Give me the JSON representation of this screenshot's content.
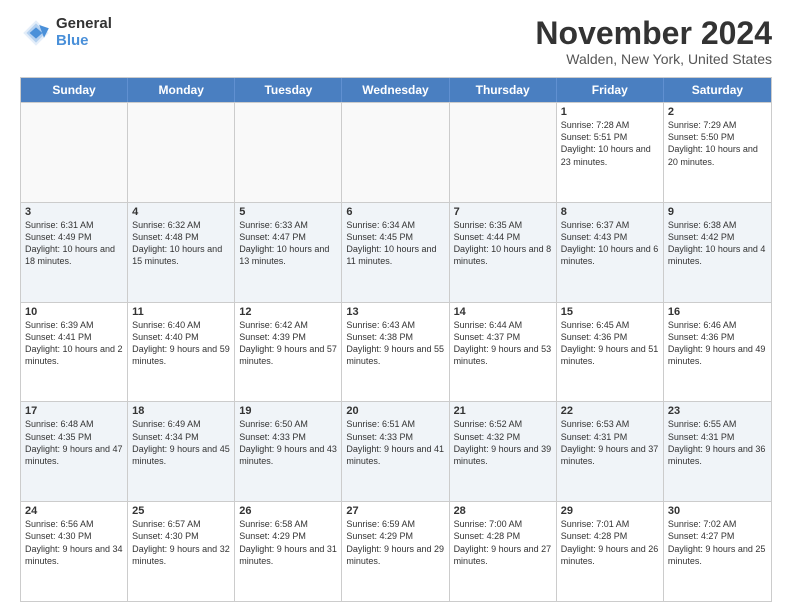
{
  "logo": {
    "general": "General",
    "blue": "Blue"
  },
  "title": "November 2024",
  "location": "Walden, New York, United States",
  "header_days": [
    "Sunday",
    "Monday",
    "Tuesday",
    "Wednesday",
    "Thursday",
    "Friday",
    "Saturday"
  ],
  "rows": [
    {
      "alt": false,
      "cells": [
        {
          "day": "",
          "info": ""
        },
        {
          "day": "",
          "info": ""
        },
        {
          "day": "",
          "info": ""
        },
        {
          "day": "",
          "info": ""
        },
        {
          "day": "",
          "info": ""
        },
        {
          "day": "1",
          "info": "Sunrise: 7:28 AM\nSunset: 5:51 PM\nDaylight: 10 hours and 23 minutes."
        },
        {
          "day": "2",
          "info": "Sunrise: 7:29 AM\nSunset: 5:50 PM\nDaylight: 10 hours and 20 minutes."
        }
      ]
    },
    {
      "alt": true,
      "cells": [
        {
          "day": "3",
          "info": "Sunrise: 6:31 AM\nSunset: 4:49 PM\nDaylight: 10 hours and 18 minutes."
        },
        {
          "day": "4",
          "info": "Sunrise: 6:32 AM\nSunset: 4:48 PM\nDaylight: 10 hours and 15 minutes."
        },
        {
          "day": "5",
          "info": "Sunrise: 6:33 AM\nSunset: 4:47 PM\nDaylight: 10 hours and 13 minutes."
        },
        {
          "day": "6",
          "info": "Sunrise: 6:34 AM\nSunset: 4:45 PM\nDaylight: 10 hours and 11 minutes."
        },
        {
          "day": "7",
          "info": "Sunrise: 6:35 AM\nSunset: 4:44 PM\nDaylight: 10 hours and 8 minutes."
        },
        {
          "day": "8",
          "info": "Sunrise: 6:37 AM\nSunset: 4:43 PM\nDaylight: 10 hours and 6 minutes."
        },
        {
          "day": "9",
          "info": "Sunrise: 6:38 AM\nSunset: 4:42 PM\nDaylight: 10 hours and 4 minutes."
        }
      ]
    },
    {
      "alt": false,
      "cells": [
        {
          "day": "10",
          "info": "Sunrise: 6:39 AM\nSunset: 4:41 PM\nDaylight: 10 hours and 2 minutes."
        },
        {
          "day": "11",
          "info": "Sunrise: 6:40 AM\nSunset: 4:40 PM\nDaylight: 9 hours and 59 minutes."
        },
        {
          "day": "12",
          "info": "Sunrise: 6:42 AM\nSunset: 4:39 PM\nDaylight: 9 hours and 57 minutes."
        },
        {
          "day": "13",
          "info": "Sunrise: 6:43 AM\nSunset: 4:38 PM\nDaylight: 9 hours and 55 minutes."
        },
        {
          "day": "14",
          "info": "Sunrise: 6:44 AM\nSunset: 4:37 PM\nDaylight: 9 hours and 53 minutes."
        },
        {
          "day": "15",
          "info": "Sunrise: 6:45 AM\nSunset: 4:36 PM\nDaylight: 9 hours and 51 minutes."
        },
        {
          "day": "16",
          "info": "Sunrise: 6:46 AM\nSunset: 4:36 PM\nDaylight: 9 hours and 49 minutes."
        }
      ]
    },
    {
      "alt": true,
      "cells": [
        {
          "day": "17",
          "info": "Sunrise: 6:48 AM\nSunset: 4:35 PM\nDaylight: 9 hours and 47 minutes."
        },
        {
          "day": "18",
          "info": "Sunrise: 6:49 AM\nSunset: 4:34 PM\nDaylight: 9 hours and 45 minutes."
        },
        {
          "day": "19",
          "info": "Sunrise: 6:50 AM\nSunset: 4:33 PM\nDaylight: 9 hours and 43 minutes."
        },
        {
          "day": "20",
          "info": "Sunrise: 6:51 AM\nSunset: 4:33 PM\nDaylight: 9 hours and 41 minutes."
        },
        {
          "day": "21",
          "info": "Sunrise: 6:52 AM\nSunset: 4:32 PM\nDaylight: 9 hours and 39 minutes."
        },
        {
          "day": "22",
          "info": "Sunrise: 6:53 AM\nSunset: 4:31 PM\nDaylight: 9 hours and 37 minutes."
        },
        {
          "day": "23",
          "info": "Sunrise: 6:55 AM\nSunset: 4:31 PM\nDaylight: 9 hours and 36 minutes."
        }
      ]
    },
    {
      "alt": false,
      "cells": [
        {
          "day": "24",
          "info": "Sunrise: 6:56 AM\nSunset: 4:30 PM\nDaylight: 9 hours and 34 minutes."
        },
        {
          "day": "25",
          "info": "Sunrise: 6:57 AM\nSunset: 4:30 PM\nDaylight: 9 hours and 32 minutes."
        },
        {
          "day": "26",
          "info": "Sunrise: 6:58 AM\nSunset: 4:29 PM\nDaylight: 9 hours and 31 minutes."
        },
        {
          "day": "27",
          "info": "Sunrise: 6:59 AM\nSunset: 4:29 PM\nDaylight: 9 hours and 29 minutes."
        },
        {
          "day": "28",
          "info": "Sunrise: 7:00 AM\nSunset: 4:28 PM\nDaylight: 9 hours and 27 minutes."
        },
        {
          "day": "29",
          "info": "Sunrise: 7:01 AM\nSunset: 4:28 PM\nDaylight: 9 hours and 26 minutes."
        },
        {
          "day": "30",
          "info": "Sunrise: 7:02 AM\nSunset: 4:27 PM\nDaylight: 9 hours and 25 minutes."
        }
      ]
    }
  ]
}
